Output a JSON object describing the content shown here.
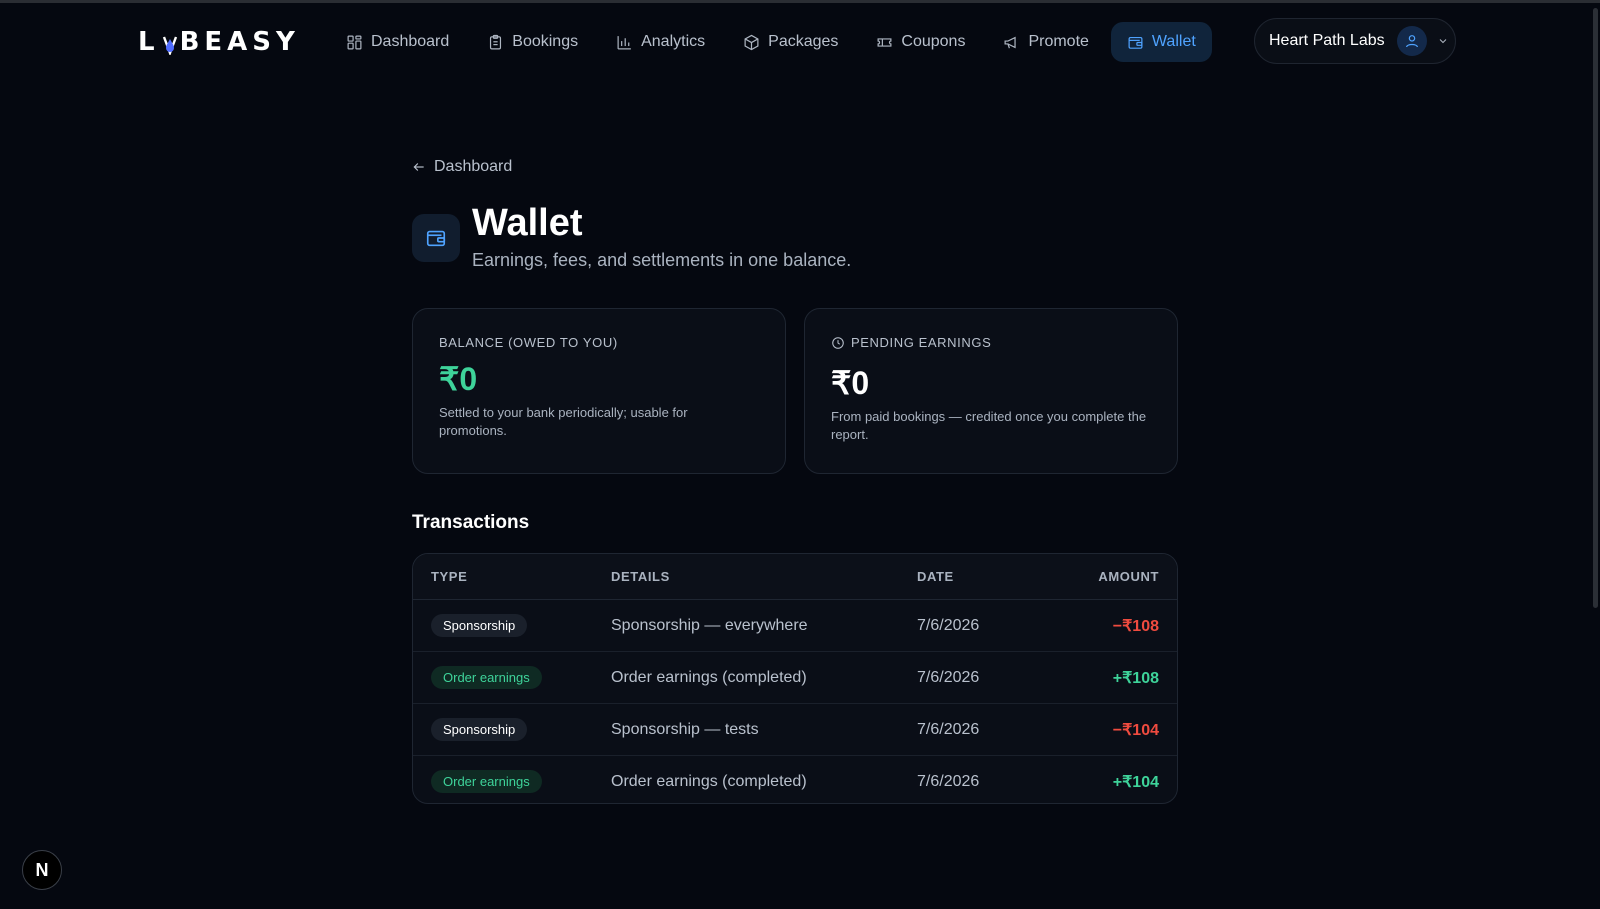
{
  "nav": {
    "logo_left": "L",
    "logo_right": "BEASY",
    "items": [
      {
        "label": "Dashboard",
        "icon": "grid-icon"
      },
      {
        "label": "Bookings",
        "icon": "clipboard-icon"
      },
      {
        "label": "Analytics",
        "icon": "bar-chart-icon"
      },
      {
        "label": "Packages",
        "icon": "package-icon"
      },
      {
        "label": "Coupons",
        "icon": "ticket-icon"
      },
      {
        "label": "Promote",
        "icon": "megaphone-icon"
      },
      {
        "label": "Wallet",
        "icon": "wallet-icon",
        "active": true
      }
    ],
    "account_name": "Heart Path Labs"
  },
  "back_link": "Dashboard",
  "header": {
    "title": "Wallet",
    "subtitle": "Earnings, fees, and settlements in one balance."
  },
  "cards": {
    "balance": {
      "label": "BALANCE (OWED TO YOU)",
      "amount": "₹0",
      "note": "Settled to your bank periodically; usable for promotions."
    },
    "pending": {
      "label": "PENDING EARNINGS",
      "amount": "₹0",
      "note": "From paid bookings — credited once you complete the report."
    }
  },
  "transactions": {
    "title": "Transactions",
    "columns": [
      "TYPE",
      "DETAILS",
      "DATE",
      "AMOUNT"
    ],
    "rows": [
      {
        "type": "Sponsorship",
        "details": "Sponsorship — everywhere",
        "date": "7/6/2026",
        "amount": "−₹108"
      },
      {
        "type": "Order earnings",
        "details": "Order earnings (completed)",
        "date": "7/6/2026",
        "amount": "+₹108"
      },
      {
        "type": "Sponsorship",
        "details": "Sponsorship — tests",
        "date": "7/6/2026",
        "amount": "−₹104"
      },
      {
        "type": "Order earnings",
        "details": "Order earnings (completed)",
        "date": "7/6/2026",
        "amount": "+₹104"
      }
    ]
  },
  "dev_badge": "N",
  "colors": {
    "background": "#050810",
    "accent_blue": "#4fa3ff",
    "positive": "#3ed39a",
    "negative": "#ef4b3f"
  }
}
